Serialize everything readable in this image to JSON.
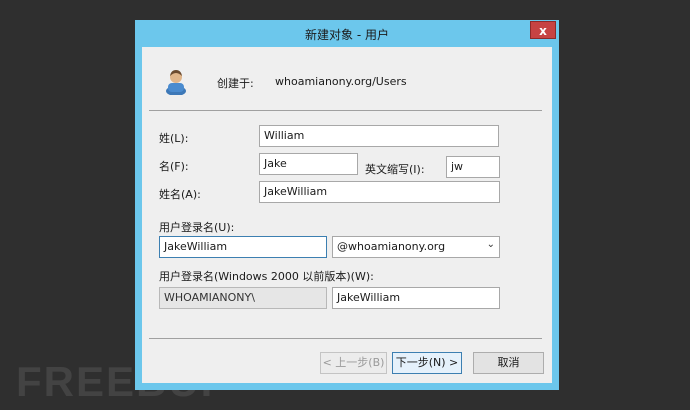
{
  "window": {
    "title": "新建对象 - 用户",
    "close_glyph": "x"
  },
  "header": {
    "created_in_label": "创建于:",
    "created_in_value": "whoamianony.org/Users"
  },
  "form": {
    "last_name_label": "姓(L):",
    "last_name_value": "William",
    "first_name_label": "名(F):",
    "first_name_value": "Jake",
    "initials_label": "英文缩写(I):",
    "initials_value": "jw",
    "full_name_label": "姓名(A):",
    "full_name_value": "JakeWilliam",
    "logon_name_label": "用户登录名(U):",
    "logon_name_value": "JakeWilliam",
    "domain_suffix_value": "@whoamianony.org",
    "pre2000_label": "用户登录名(Windows 2000 以前版本)(W):",
    "pre2000_domain_value": "WHOAMIANONY\\",
    "pre2000_name_value": "JakeWilliam"
  },
  "buttons": {
    "back_label": "< 上一步(B)",
    "next_label": "下一步(N) >",
    "cancel_label": "取消"
  },
  "watermark": {
    "text": "FREEBUF"
  },
  "colors": {
    "titlebar": "#6cc7ec",
    "close": "#c74343",
    "client": "#efefef",
    "focus": "#3c7fb1"
  },
  "icons": {
    "user": "user-icon",
    "dropdown": "chevron-down-icon",
    "close": "close-icon"
  }
}
